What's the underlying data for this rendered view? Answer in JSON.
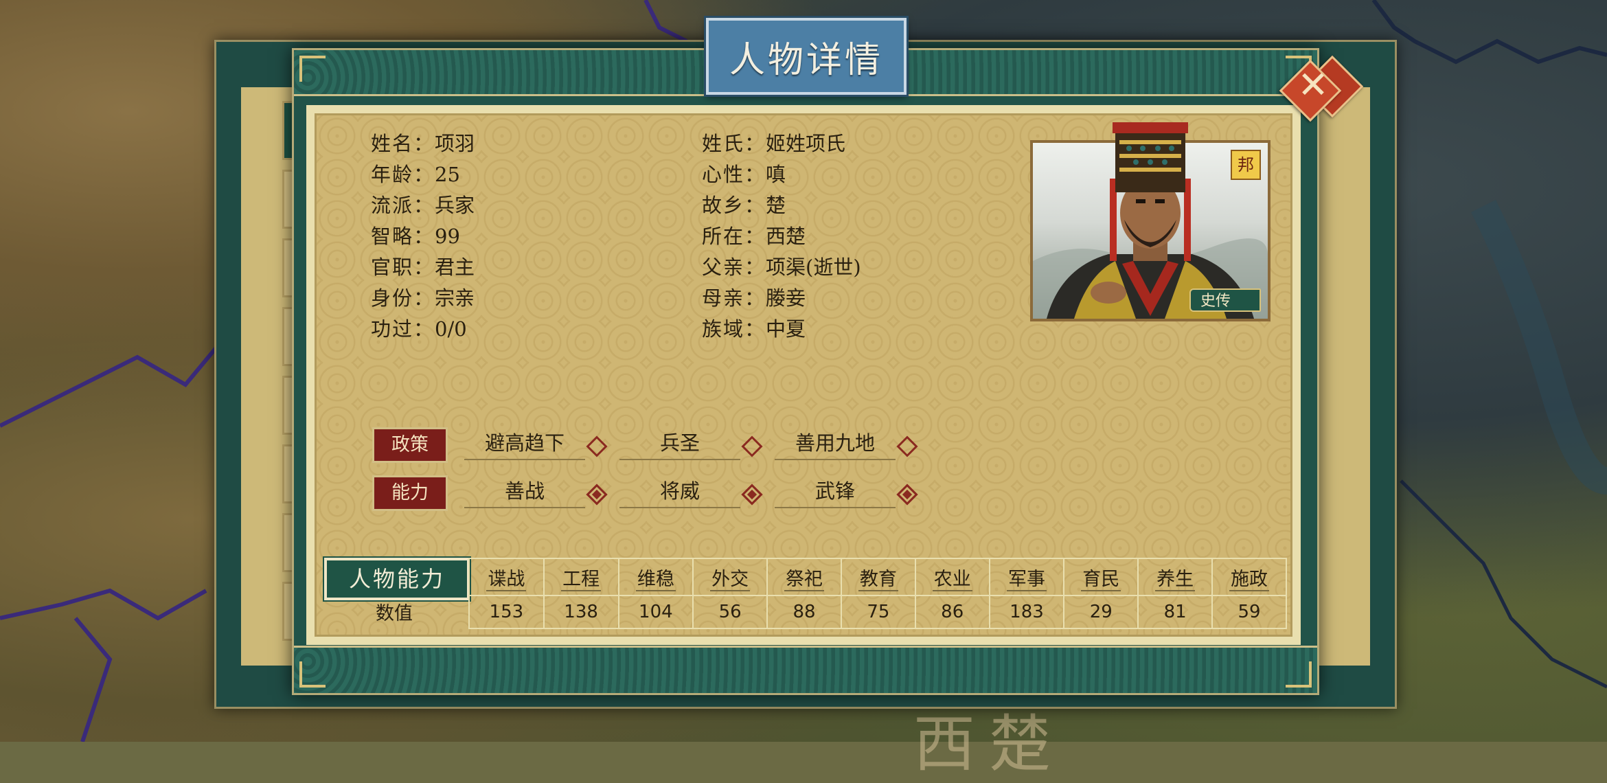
{
  "dialog": {
    "title": "人物详情",
    "close_icon": "close-icon"
  },
  "map": {
    "region_label": "西楚"
  },
  "character": {
    "left_fields": [
      {
        "label": "姓名：",
        "value": "项羽"
      },
      {
        "label": "年龄：",
        "value": "25"
      },
      {
        "label": "流派：",
        "value": "兵家"
      },
      {
        "label": "智略：",
        "value": "99"
      },
      {
        "label": "官职：",
        "value": "君主"
      },
      {
        "label": "身份：",
        "value": "宗亲"
      },
      {
        "label": "功过：",
        "value": "0/0"
      }
    ],
    "right_fields": [
      {
        "label": "姓氏：",
        "value": "姬姓项氏"
      },
      {
        "label": "心性：",
        "value": "嗔"
      },
      {
        "label": "故乡：",
        "value": "楚"
      },
      {
        "label": "所在：",
        "value": "西楚"
      },
      {
        "label": "父亲：",
        "value": "项渠(逝世)"
      },
      {
        "label": "母亲：",
        "value": "媵妾"
      },
      {
        "label": "族域：",
        "value": "中夏"
      }
    ],
    "portrait": {
      "badge": "邦",
      "biography_button": "史传"
    }
  },
  "traits": {
    "policy_label": "政策",
    "policy_items": [
      "避高趋下",
      "兵圣",
      "善用九地"
    ],
    "ability_label": "能力",
    "ability_items": [
      "善战",
      "将威",
      "武锋"
    ]
  },
  "stats": {
    "tab_label": "人物能力",
    "row_label": "数值",
    "columns": [
      "谍战",
      "工程",
      "维稳",
      "外交",
      "祭祀",
      "教育",
      "农业",
      "军事",
      "育民",
      "养生",
      "施政"
    ],
    "values": [
      "153",
      "138",
      "104",
      "56",
      "88",
      "75",
      "86",
      "183",
      "29",
      "81",
      "59"
    ]
  }
}
